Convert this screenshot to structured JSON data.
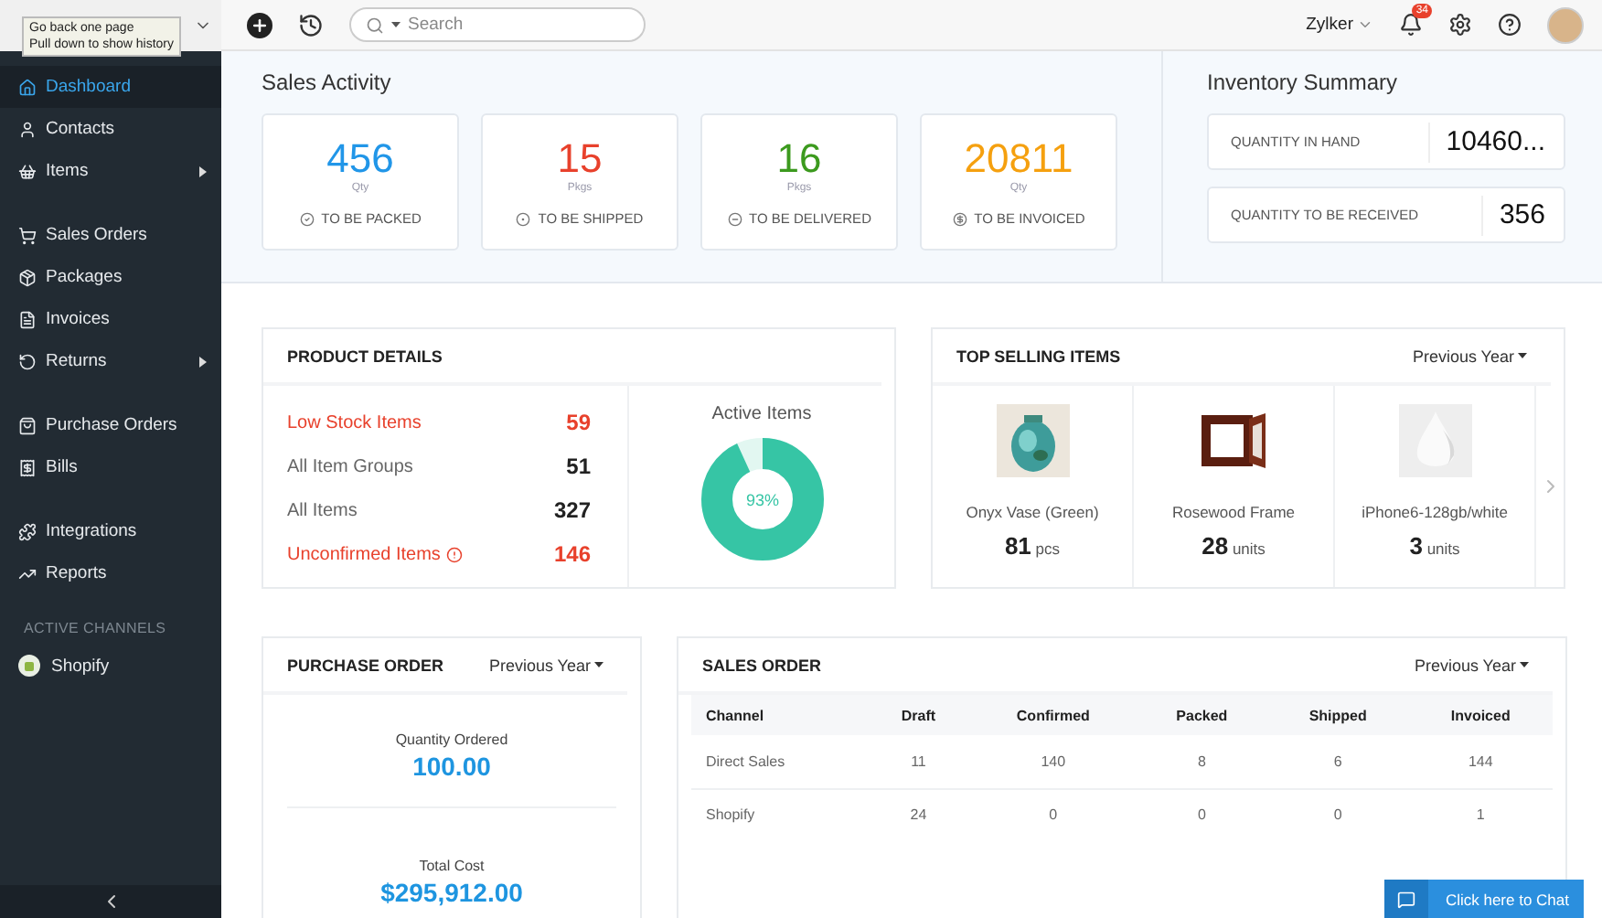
{
  "browser_tooltip": {
    "lines": [
      "Go back one page",
      "Pull down to show history"
    ]
  },
  "topbar": {
    "search": {
      "placeholder": "Search"
    },
    "organization": "Zylker",
    "notification_count": "34"
  },
  "sidebar": {
    "groups": [
      [
        {
          "label": "Dashboard",
          "selected": true,
          "has_submenu": false
        },
        {
          "label": "Contacts",
          "selected": false,
          "has_submenu": false
        },
        {
          "label": "Items",
          "selected": false,
          "has_submenu": true
        }
      ],
      [
        {
          "label": "Sales Orders",
          "selected": false,
          "has_submenu": false
        },
        {
          "label": "Packages",
          "selected": false,
          "has_submenu": false
        },
        {
          "label": "Invoices",
          "selected": false,
          "has_submenu": false
        },
        {
          "label": "Returns",
          "selected": false,
          "has_submenu": true
        }
      ],
      [
        {
          "label": "Purchase Orders",
          "selected": false,
          "has_submenu": false
        },
        {
          "label": "Bills",
          "selected": false,
          "has_submenu": false
        }
      ],
      [
        {
          "label": "Integrations",
          "selected": false,
          "has_submenu": false
        },
        {
          "label": "Reports",
          "selected": false,
          "has_submenu": false
        }
      ]
    ],
    "section_title": "ACTIVE CHANNELS",
    "channels": [
      {
        "label": "Shopify"
      }
    ]
  },
  "sales_activity": {
    "title": "Sales Activity",
    "cards": [
      {
        "value": "456",
        "unit": "Qty",
        "label": "TO BE PACKED",
        "color": "#2196e8"
      },
      {
        "value": "15",
        "unit": "Pkgs",
        "label": "TO BE SHIPPED",
        "color": "#e8412c"
      },
      {
        "value": "16",
        "unit": "Pkgs",
        "label": "TO BE DELIVERED",
        "color": "#3c9a1e"
      },
      {
        "value": "20811",
        "unit": "Qty",
        "label": "TO BE INVOICED",
        "color": "#f5a00f"
      }
    ]
  },
  "inventory_summary": {
    "title": "Inventory Summary",
    "rows": [
      {
        "label": "QUANTITY IN HAND",
        "value": "10460..."
      },
      {
        "label": "QUANTITY TO BE RECEIVED",
        "value": "356"
      }
    ]
  },
  "product_details": {
    "title": "PRODUCT DETAILS",
    "rows": [
      {
        "label": "Low Stock Items",
        "value": "59",
        "alert": true,
        "info": false
      },
      {
        "label": "All Item Groups",
        "value": "51",
        "alert": false,
        "info": false
      },
      {
        "label": "All Items",
        "value": "327",
        "alert": false,
        "info": false
      },
      {
        "label": "Unconfirmed Items",
        "value": "146",
        "alert": true,
        "info": true
      }
    ],
    "active_items": {
      "title": "Active Items",
      "level": 0.93,
      "reading": "93%"
    }
  },
  "top_selling": {
    "title": "TOP SELLING ITEMS",
    "period": "Previous Year",
    "items": [
      {
        "kind": "picture",
        "name": "Onyx Vase (Green)",
        "quantity": "81",
        "unit": "pcs"
      },
      {
        "kind": "picture",
        "name": "Rosewood Frame",
        "quantity": "28",
        "unit": "units"
      },
      {
        "kind": "picture",
        "name": "iPhone6-128gb/white",
        "quantity": "3",
        "unit": "units"
      }
    ]
  },
  "purchase_order": {
    "title": "PURCHASE ORDER",
    "period": "Previous Year",
    "stats": [
      {
        "label": "Quantity Ordered",
        "value": "100.00"
      },
      {
        "label": "Total Cost",
        "value": "$295,912.00"
      }
    ]
  },
  "sales_order": {
    "title": "SALES ORDER",
    "period": "Previous Year",
    "columns": [
      "Channel",
      "Draft",
      "Confirmed",
      "Packed",
      "Shipped",
      "Invoiced"
    ],
    "rows": [
      [
        "Direct Sales",
        "11",
        "140",
        "8",
        "6",
        "144"
      ],
      [
        "Shopify",
        "24",
        "0",
        "0",
        "0",
        "1"
      ]
    ]
  },
  "chat_button": {
    "label": "Click here to Chat"
  }
}
